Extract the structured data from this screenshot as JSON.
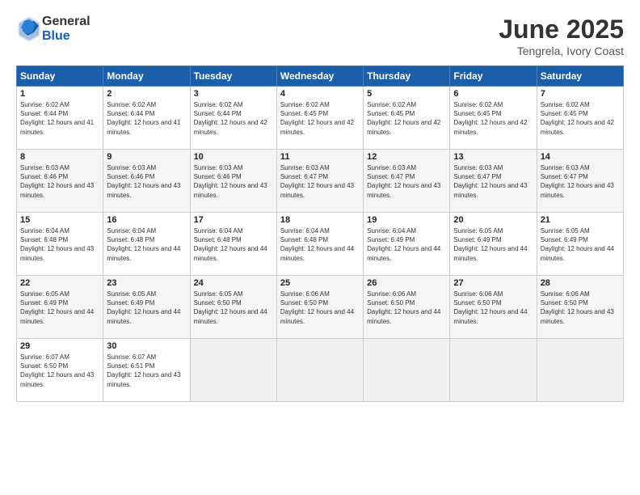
{
  "header": {
    "logo_general": "General",
    "logo_blue": "Blue",
    "title": "June 2025",
    "subtitle": "Tengrela, Ivory Coast"
  },
  "calendar": {
    "days_of_week": [
      "Sunday",
      "Monday",
      "Tuesday",
      "Wednesday",
      "Thursday",
      "Friday",
      "Saturday"
    ],
    "weeks": [
      [
        null,
        null,
        null,
        null,
        null,
        null,
        null
      ]
    ],
    "cells": [
      {
        "day": 1,
        "col": 0,
        "sunrise": "6:02 AM",
        "sunset": "6:44 PM",
        "daylight": "12 hours and 41 minutes."
      },
      {
        "day": 2,
        "col": 1,
        "sunrise": "6:02 AM",
        "sunset": "6:44 PM",
        "daylight": "12 hours and 41 minutes."
      },
      {
        "day": 3,
        "col": 2,
        "sunrise": "6:02 AM",
        "sunset": "6:44 PM",
        "daylight": "12 hours and 42 minutes."
      },
      {
        "day": 4,
        "col": 3,
        "sunrise": "6:02 AM",
        "sunset": "6:45 PM",
        "daylight": "12 hours and 42 minutes."
      },
      {
        "day": 5,
        "col": 4,
        "sunrise": "6:02 AM",
        "sunset": "6:45 PM",
        "daylight": "12 hours and 42 minutes."
      },
      {
        "day": 6,
        "col": 5,
        "sunrise": "6:02 AM",
        "sunset": "6:45 PM",
        "daylight": "12 hours and 42 minutes."
      },
      {
        "day": 7,
        "col": 6,
        "sunrise": "6:02 AM",
        "sunset": "6:45 PM",
        "daylight": "12 hours and 42 minutes."
      },
      {
        "day": 8,
        "col": 0,
        "sunrise": "6:03 AM",
        "sunset": "6:46 PM",
        "daylight": "12 hours and 43 minutes."
      },
      {
        "day": 9,
        "col": 1,
        "sunrise": "6:03 AM",
        "sunset": "6:46 PM",
        "daylight": "12 hours and 43 minutes."
      },
      {
        "day": 10,
        "col": 2,
        "sunrise": "6:03 AM",
        "sunset": "6:46 PM",
        "daylight": "12 hours and 43 minutes."
      },
      {
        "day": 11,
        "col": 3,
        "sunrise": "6:03 AM",
        "sunset": "6:47 PM",
        "daylight": "12 hours and 43 minutes."
      },
      {
        "day": 12,
        "col": 4,
        "sunrise": "6:03 AM",
        "sunset": "6:47 PM",
        "daylight": "12 hours and 43 minutes."
      },
      {
        "day": 13,
        "col": 5,
        "sunrise": "6:03 AM",
        "sunset": "6:47 PM",
        "daylight": "12 hours and 43 minutes."
      },
      {
        "day": 14,
        "col": 6,
        "sunrise": "6:03 AM",
        "sunset": "6:47 PM",
        "daylight": "12 hours and 43 minutes."
      },
      {
        "day": 15,
        "col": 0,
        "sunrise": "6:04 AM",
        "sunset": "6:48 PM",
        "daylight": "12 hours and 43 minutes."
      },
      {
        "day": 16,
        "col": 1,
        "sunrise": "6:04 AM",
        "sunset": "6:48 PM",
        "daylight": "12 hours and 44 minutes."
      },
      {
        "day": 17,
        "col": 2,
        "sunrise": "6:04 AM",
        "sunset": "6:48 PM",
        "daylight": "12 hours and 44 minutes."
      },
      {
        "day": 18,
        "col": 3,
        "sunrise": "6:04 AM",
        "sunset": "6:48 PM",
        "daylight": "12 hours and 44 minutes."
      },
      {
        "day": 19,
        "col": 4,
        "sunrise": "6:04 AM",
        "sunset": "6:49 PM",
        "daylight": "12 hours and 44 minutes."
      },
      {
        "day": 20,
        "col": 5,
        "sunrise": "6:05 AM",
        "sunset": "6:49 PM",
        "daylight": "12 hours and 44 minutes."
      },
      {
        "day": 21,
        "col": 6,
        "sunrise": "6:05 AM",
        "sunset": "6:49 PM",
        "daylight": "12 hours and 44 minutes."
      },
      {
        "day": 22,
        "col": 0,
        "sunrise": "6:05 AM",
        "sunset": "6:49 PM",
        "daylight": "12 hours and 44 minutes."
      },
      {
        "day": 23,
        "col": 1,
        "sunrise": "6:05 AM",
        "sunset": "6:49 PM",
        "daylight": "12 hours and 44 minutes."
      },
      {
        "day": 24,
        "col": 2,
        "sunrise": "6:05 AM",
        "sunset": "6:50 PM",
        "daylight": "12 hours and 44 minutes."
      },
      {
        "day": 25,
        "col": 3,
        "sunrise": "6:06 AM",
        "sunset": "6:50 PM",
        "daylight": "12 hours and 44 minutes."
      },
      {
        "day": 26,
        "col": 4,
        "sunrise": "6:06 AM",
        "sunset": "6:50 PM",
        "daylight": "12 hours and 44 minutes."
      },
      {
        "day": 27,
        "col": 5,
        "sunrise": "6:06 AM",
        "sunset": "6:50 PM",
        "daylight": "12 hours and 44 minutes."
      },
      {
        "day": 28,
        "col": 6,
        "sunrise": "6:06 AM",
        "sunset": "6:50 PM",
        "daylight": "12 hours and 43 minutes."
      },
      {
        "day": 29,
        "col": 0,
        "sunrise": "6:07 AM",
        "sunset": "6:50 PM",
        "daylight": "12 hours and 43 minutes."
      },
      {
        "day": 30,
        "col": 1,
        "sunrise": "6:07 AM",
        "sunset": "6:51 PM",
        "daylight": "12 hours and 43 minutes."
      }
    ]
  }
}
